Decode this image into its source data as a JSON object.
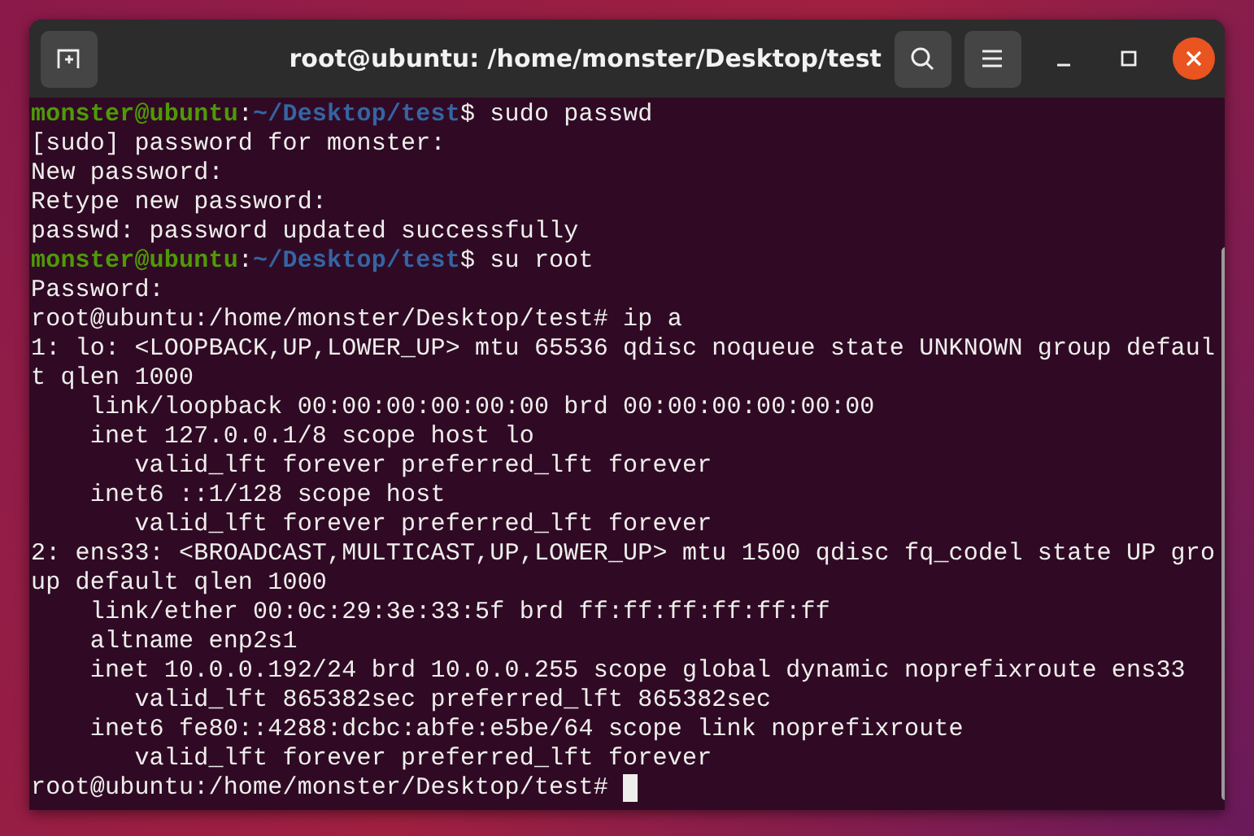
{
  "window": {
    "title": "root@ubuntu: /home/monster/Desktop/test"
  },
  "terminal": {
    "lines": [
      {
        "kind": "prompt",
        "user_host": "monster@ubuntu",
        "separator": ":",
        "path": "~/Desktop/test",
        "command": "$ sudo passwd"
      },
      {
        "kind": "output",
        "text": "[sudo] password for monster:"
      },
      {
        "kind": "output",
        "text": "New password:"
      },
      {
        "kind": "output",
        "text": "Retype new password:"
      },
      {
        "kind": "output",
        "text": "passwd: password updated successfully"
      },
      {
        "kind": "prompt",
        "user_host": "monster@ubuntu",
        "separator": ":",
        "path": "~/Desktop/test",
        "command": "$ su root"
      },
      {
        "kind": "output",
        "text": "Password:"
      },
      {
        "kind": "output",
        "text": "root@ubuntu:/home/monster/Desktop/test# ip a"
      },
      {
        "kind": "output",
        "text": "1: lo: <LOOPBACK,UP,LOWER_UP> mtu 65536 qdisc noqueue state UNKNOWN group defaul"
      },
      {
        "kind": "output",
        "text": "t qlen 1000"
      },
      {
        "kind": "output",
        "text": "    link/loopback 00:00:00:00:00:00 brd 00:00:00:00:00:00"
      },
      {
        "kind": "output",
        "text": "    inet 127.0.0.1/8 scope host lo"
      },
      {
        "kind": "output",
        "text": "       valid_lft forever preferred_lft forever"
      },
      {
        "kind": "output",
        "text": "    inet6 ::1/128 scope host"
      },
      {
        "kind": "output",
        "text": "       valid_lft forever preferred_lft forever"
      },
      {
        "kind": "output",
        "text": "2: ens33: <BROADCAST,MULTICAST,UP,LOWER_UP> mtu 1500 qdisc fq_codel state UP gro"
      },
      {
        "kind": "output",
        "text": "up default qlen 1000"
      },
      {
        "kind": "output",
        "text": "    link/ether 00:0c:29:3e:33:5f brd ff:ff:ff:ff:ff:ff"
      },
      {
        "kind": "output",
        "text": "    altname enp2s1"
      },
      {
        "kind": "output",
        "text": "    inet 10.0.0.192/24 brd 10.0.0.255 scope global dynamic noprefixroute ens33"
      },
      {
        "kind": "output",
        "text": "       valid_lft 865382sec preferred_lft 865382sec"
      },
      {
        "kind": "output",
        "text": "    inet6 fe80::4288:dcbc:abfe:e5be/64 scope link noprefixroute"
      },
      {
        "kind": "output",
        "text": "       valid_lft forever preferred_lft forever"
      },
      {
        "kind": "input",
        "text": "root@ubuntu:/home/monster/Desktop/test# ",
        "cursor": true
      }
    ]
  }
}
